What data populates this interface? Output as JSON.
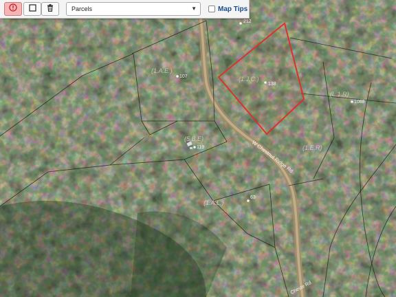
{
  "toolbar": {
    "identify_icon": "identify-icon",
    "select_icon": "square-icon",
    "delete_icon": "trash-icon",
    "layer_select": {
      "value": "Parcels"
    },
    "map_tips": {
      "label": "Map Tips",
      "checked": false
    }
  },
  "map": {
    "highlight_color": "#d9342b",
    "address_labels": [
      "212",
      "107",
      "138",
      "1088",
      "119",
      "63"
    ],
    "road_labels": [
      "W Chestnut Ridge Rd",
      "Cheste Rd"
    ]
  }
}
